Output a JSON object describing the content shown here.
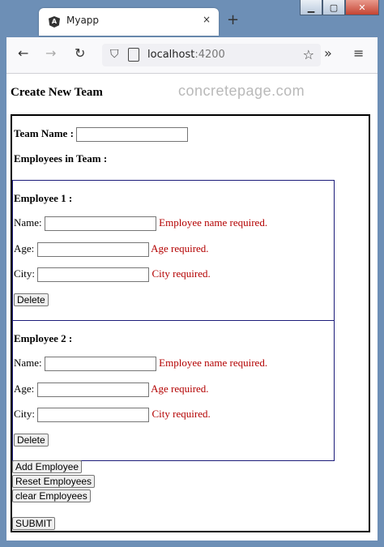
{
  "browser": {
    "tab_title": "Myapp",
    "tab_close": "×",
    "new_tab": "+",
    "url_host": "localhost",
    "url_port": ":4200",
    "back": "←",
    "forward": "→",
    "reload": "↻",
    "star": "☆",
    "overflow": "»",
    "menu": "≡"
  },
  "watermark": "concretepage.com",
  "page_title": "Create New Team",
  "team_name_label": "Team Name :",
  "team_name_value": "",
  "employees_label": "Employees in Team :",
  "employees": [
    {
      "heading": "Employee 1 :",
      "name_label": "Name:",
      "name_value": "",
      "name_error": "Employee name required.",
      "age_label": "Age:",
      "age_value": "",
      "age_error": "Age required.",
      "city_label": "City:",
      "city_value": "",
      "city_error": "City required.",
      "delete_label": "Delete"
    },
    {
      "heading": "Employee 2 :",
      "name_label": "Name:",
      "name_value": "",
      "name_error": "Employee name required.",
      "age_label": "Age:",
      "age_value": "",
      "age_error": "Age required.",
      "city_label": "City:",
      "city_value": "",
      "city_error": "City required.",
      "delete_label": "Delete"
    }
  ],
  "buttons": {
    "add_employee": "Add Employee",
    "reset_employees": "Reset Employees",
    "clear_employees": "clear Employees",
    "submit": "SUBMIT"
  },
  "colors": {
    "error": "#b30000",
    "employee_border": "#1c1c7a",
    "window_frame": "#6d8fb6"
  }
}
